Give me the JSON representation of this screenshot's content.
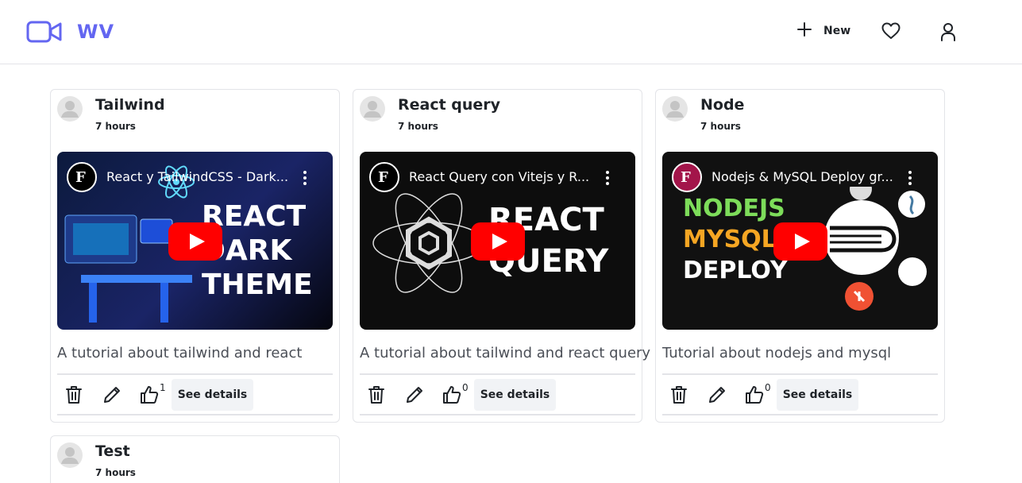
{
  "brand": {
    "name": "WV",
    "accent": "#6366f1"
  },
  "nav": {
    "new_label": "New"
  },
  "icons": {
    "logo": "video-camera-icon",
    "new": "plus-icon",
    "favorites": "heart-icon",
    "profile": "user-icon",
    "delete": "trash-icon",
    "edit": "pencil-icon",
    "like": "thumbs-up-icon",
    "play": "youtube-play-icon"
  },
  "posts": [
    {
      "title": "Tailwind",
      "time": "7 hours",
      "video_title": "React y TailwindCSS - Dark...",
      "thumb_lines": [
        "REACT",
        "DARK",
        "THEME"
      ],
      "description": "A tutorial about tailwind and react",
      "likes": "1",
      "details_label": "See details"
    },
    {
      "title": "React query",
      "time": "7 hours",
      "video_title": "React Query con Vitejs y R...",
      "thumb_lines": [
        "REACT",
        "QUERY"
      ],
      "description": "A tutorial about tailwind and react query",
      "likes": "0",
      "details_label": "See details"
    },
    {
      "title": "Node",
      "time": "7 hours",
      "video_title": "Nodejs & MySQL Deploy gr...",
      "thumb_lines": [
        "NODEJS",
        "MYSQL",
        "DEPLOY"
      ],
      "description": "Tutorial about nodejs and mysql",
      "likes": "0",
      "details_label": "See details"
    },
    {
      "title": "Test",
      "time": "7 hours"
    }
  ]
}
